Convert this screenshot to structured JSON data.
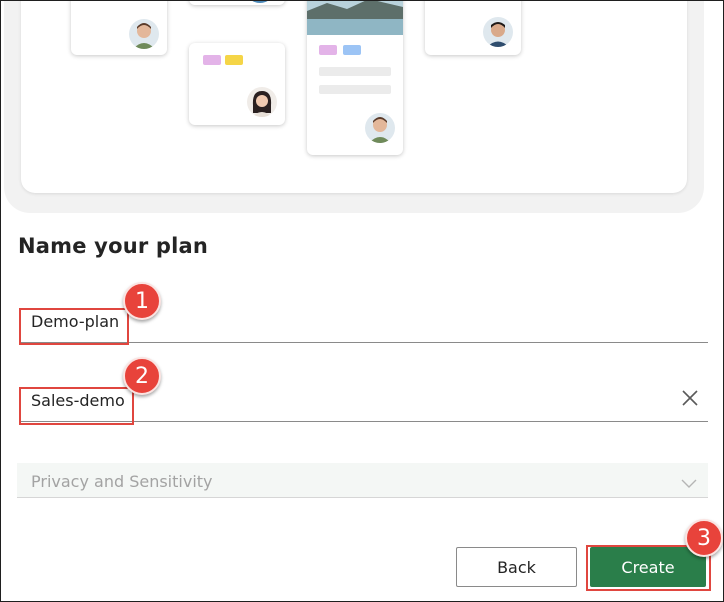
{
  "form": {
    "heading": "Name your plan",
    "plan_name_value": "Demo-plan",
    "group_value": "Sales-demo",
    "privacy_placeholder": "Privacy and Sensitivity"
  },
  "buttons": {
    "back_label": "Back",
    "create_label": "Create"
  },
  "callouts": {
    "one": "1",
    "two": "2",
    "three": "3"
  },
  "colors": {
    "accent_green": "#2a7e4a",
    "callout_red": "#e8433b"
  },
  "icons": {
    "clear": "close-icon",
    "dropdown": "chevron-down-icon"
  }
}
